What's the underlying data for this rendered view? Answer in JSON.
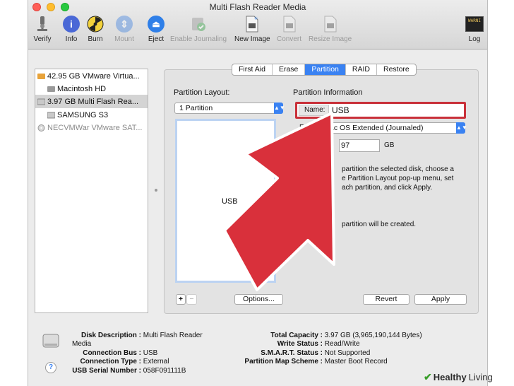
{
  "window": {
    "title": "Multi Flash Reader Media"
  },
  "toolbar": {
    "verify": "Verify",
    "info": "Info",
    "burn": "Burn",
    "mount": "Mount",
    "eject": "Eject",
    "journaling": "Enable Journaling",
    "new_image": "New Image",
    "convert": "Convert",
    "resize_image": "Resize Image",
    "log": "Log",
    "log_icon_text": "WARNI"
  },
  "sidebar": {
    "items": [
      {
        "label": "42.95 GB VMware Virtua..."
      },
      {
        "label": "Macintosh HD"
      },
      {
        "label": "3.97 GB Multi Flash Rea..."
      },
      {
        "label": "SAMSUNG S3"
      },
      {
        "label": "NECVMWar VMware SAT..."
      }
    ]
  },
  "tabs": [
    "First Aid",
    "Erase",
    "Partition",
    "RAID",
    "Restore"
  ],
  "partition": {
    "layout_heading": "Partition Layout:",
    "layout_value": "1 Partition",
    "partition_name": "USB",
    "add_btn": "+",
    "remove_btn": "−",
    "options_btn": "Options..."
  },
  "info": {
    "heading": "Partition Information",
    "name_label": "Name:",
    "name_value": "USB",
    "format_label": "Format",
    "format_value": "ac OS Extended (Journaled)",
    "size_value": "97",
    "size_unit": "GB",
    "desc_line1": "partition the selected disk, choose a",
    "desc_line2": "e Partition Layout pop-up menu, set",
    "desc_line3": "ach partition, and click Apply.",
    "created_line": "partition will be created.",
    "revert_btn": "Revert",
    "apply_btn": "Apply"
  },
  "details": {
    "disk_description_key": "Disk Description :",
    "disk_description_val": "Multi Flash Reader Media",
    "connection_bus_key": "Connection Bus :",
    "connection_bus_val": "USB",
    "connection_type_key": "Connection Type :",
    "connection_type_val": "External",
    "serial_key": "USB Serial Number :",
    "serial_val": "058F091111B",
    "capacity_key": "Total Capacity :",
    "capacity_val": "3.97 GB (3,965,190,144 Bytes)",
    "write_key": "Write Status :",
    "write_val": "Read/Write",
    "smart_key": "S.M.A.R.T. Status :",
    "smart_val": "Not Supported",
    "map_key": "Partition Map Scheme :",
    "map_val": "Master Boot Record"
  },
  "help": {
    "label": "?"
  },
  "brand": {
    "healthy": "Healthy",
    "living": "Living"
  },
  "colors": {
    "accent": "#3a82f2",
    "highlight_box": "#c9313a",
    "arrow": "#d9303b"
  }
}
